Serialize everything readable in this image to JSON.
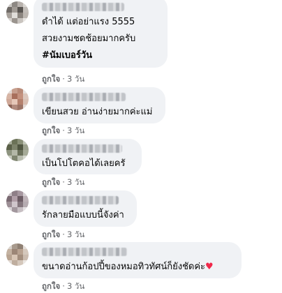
{
  "colors": {
    "bubble_bg": "#f0f2f5",
    "action_text": "#65676b",
    "heart": "#f0284a"
  },
  "comments": [
    {
      "lines": [
        "ดำได้ แต่อย่าแรง 5555",
        "สวยงามชดช้อยมากครับ",
        "#นัมเบอร์วัน"
      ],
      "like_label": "ถูกใจ",
      "separator": "·",
      "time": "3 วัน"
    },
    {
      "lines": [
        "เขียนสวย อ่านง่ายมากค่ะแม่"
      ],
      "like_label": "ถูกใจ",
      "separator": "·",
      "time": "3 วัน"
    },
    {
      "lines": [
        "เป็นโปโตคอได้เลยครั"
      ],
      "like_label": "ถูกใจ",
      "separator": "·",
      "time": "3 วัน"
    },
    {
      "lines": [
        "รักลายมือแบบนี้จังค่า"
      ],
      "like_label": "ถูกใจ",
      "separator": "·",
      "time": "3 วัน"
    },
    {
      "lines": [
        "ขนาดอ่านก้อปปี้ของหมอทิวทัศน์ก็ยังชัดค่ะ"
      ],
      "heart_icon": "heart-emoji",
      "heart_glyph": "♥",
      "like_label": "ถูกใจ",
      "separator": "·",
      "time": "3 วัน"
    }
  ]
}
